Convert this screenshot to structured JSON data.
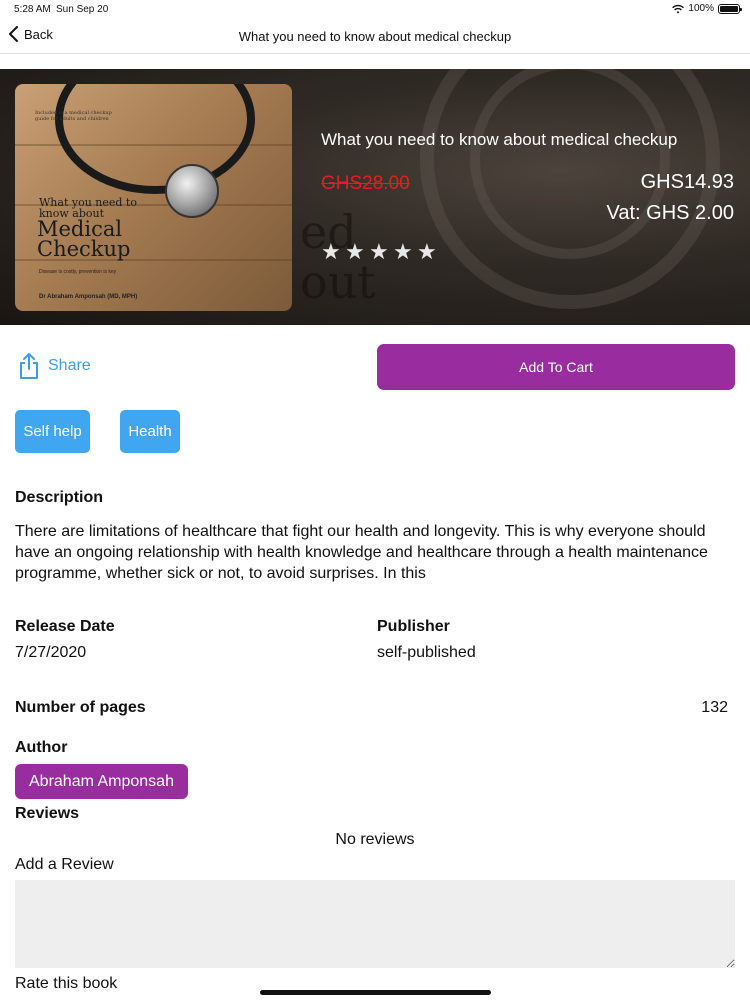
{
  "status_bar": {
    "time": "5:28 AM",
    "date": "Sun Sep 20",
    "battery": "100%"
  },
  "nav": {
    "back_label": "Back",
    "title": "What you need to know about medical checkup"
  },
  "book": {
    "title": "What you need to know about medical checkup",
    "old_price": "GHS28.00",
    "price": "GHS14.93",
    "vat": "Vat: GHS 2.00",
    "rating_stars": 5,
    "rating_value": 0,
    "cover": {
      "top_text": "Included is a medical checkup guide for adults and children",
      "subtitle": "What you need to know about",
      "main_title_line1": "Medical",
      "main_title_line2": "Checkup",
      "tagline": "Disease is costly, prevention is key",
      "author": "Dr Abraham Amponsah (MD, MPH)"
    }
  },
  "actions": {
    "share_label": "Share",
    "add_to_cart_label": "Add To Cart"
  },
  "tags": [
    "Self help",
    "Health"
  ],
  "description": {
    "heading": "Description",
    "text": "There are limitations of healthcare that fight our health and longevity. This is why everyone should have an ongoing relationship with health knowledge and healthcare through a health maintenance programme, whether sick or not, to avoid surprises. In this"
  },
  "details": {
    "release_date_label": "Release Date",
    "release_date": "7/27/2020",
    "publisher_label": "Publisher",
    "publisher": "self-published",
    "pages_label": "Number of pages",
    "pages": "132"
  },
  "author": {
    "heading": "Author",
    "name": "Abraham Amponsah"
  },
  "reviews": {
    "heading": "Reviews",
    "empty_text": "No reviews",
    "add_label": "Add a Review",
    "review_input_value": "",
    "rate_label": "Rate this book"
  },
  "colors": {
    "accent_purple": "#992c9f",
    "tag_blue": "#41a6f0",
    "share_blue": "#3d9ee8",
    "old_price_red": "#e02020"
  }
}
